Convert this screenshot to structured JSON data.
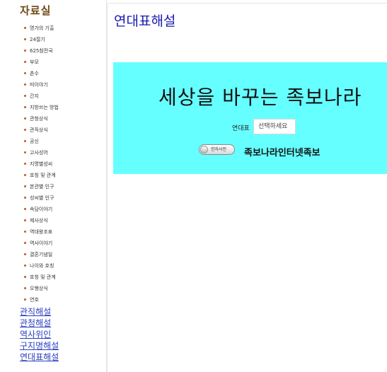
{
  "sidebar": {
    "title": "자료실",
    "sub_items": [
      {
        "label": "명가의 기출"
      },
      {
        "label": "24절기"
      },
      {
        "label": "625참전국"
      },
      {
        "label": "부모"
      },
      {
        "label": "촌수"
      },
      {
        "label": "띠이야기"
      },
      {
        "label": "간지"
      },
      {
        "label": "지방쓰는 방법"
      },
      {
        "label": "관청상식"
      },
      {
        "label": "관직상식"
      },
      {
        "label": "공신"
      },
      {
        "label": "고사성어"
      },
      {
        "label": "지명별성씨"
      },
      {
        "label": "호칭 및 관계"
      },
      {
        "label": "본관별 인구"
      },
      {
        "label": "성씨별 인구"
      },
      {
        "label": "속담이야기"
      },
      {
        "label": "제사상식"
      },
      {
        "label": "역대왕조표"
      },
      {
        "label": "역사이야기"
      },
      {
        "label": "결혼기념일"
      },
      {
        "label": "나이와 호칭"
      },
      {
        "label": "호칭 및 관계"
      },
      {
        "label": "오행상식"
      },
      {
        "label": "연호"
      }
    ],
    "main_links": [
      {
        "label": "관직해설"
      },
      {
        "label": "관청해설"
      },
      {
        "label": "역사위인"
      },
      {
        "label": "구지명해설"
      },
      {
        "label": "연대표해설"
      }
    ]
  },
  "main": {
    "page_title": "연대표해설",
    "banner_text": "세상을 바꾸는 족보나라",
    "select_label": "연대표",
    "select_value": "선택하세요",
    "toggle_label": "한자사전",
    "subtitle": "족보나라인터넷족보"
  },
  "colors": {
    "panel_background": "#66ffff",
    "link": "#2a3fbf",
    "page_title": "#1a1ab0",
    "sidebar_title": "#6b4a12",
    "bullet": "#c05a1e"
  }
}
